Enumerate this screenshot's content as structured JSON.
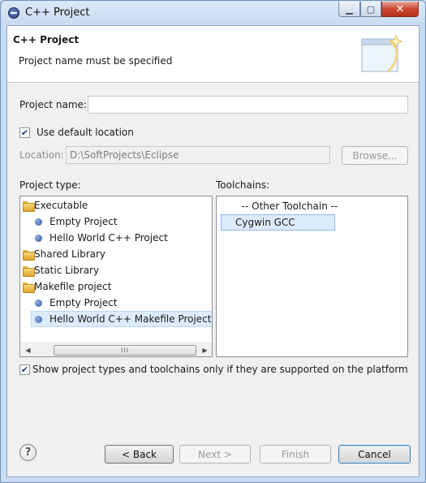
{
  "window": {
    "title": "C++ Project",
    "controls": {
      "minimize": "▁",
      "maximize": "▢",
      "close": "✕"
    }
  },
  "banner": {
    "title": "C++ Project",
    "message": "Project name must be specified"
  },
  "project_name": {
    "label": "Project name:",
    "value": ""
  },
  "default_location": {
    "label": "Use default location",
    "checked": true
  },
  "location": {
    "label": "Location:",
    "value": "D:\\SoftProjects\\Eclipse",
    "browse_label": "Browse..."
  },
  "project_type": {
    "label": "Project type:",
    "items": [
      {
        "label": "Executable",
        "icon": "folder-icon",
        "level": 0
      },
      {
        "label": "Empty Project",
        "icon": "project-bullet-icon",
        "level": 1
      },
      {
        "label": "Hello World C++ Project",
        "icon": "project-bullet-icon",
        "level": 1
      },
      {
        "label": "Shared Library",
        "icon": "folder-icon",
        "level": 0
      },
      {
        "label": "Static Library",
        "icon": "folder-icon",
        "level": 0
      },
      {
        "label": "Makefile project",
        "icon": "folder-icon",
        "level": 0
      },
      {
        "label": "Empty Project",
        "icon": "project-bullet-icon",
        "level": 1
      },
      {
        "label": "Hello World C++ Makefile Project",
        "icon": "project-bullet-icon",
        "level": 1,
        "selected": true
      }
    ],
    "scrollbar": {
      "left": "◀",
      "right": "▶",
      "grip": "III"
    }
  },
  "toolchains": {
    "label": "Toolchains:",
    "items": [
      {
        "label": "-- Other Toolchain --"
      },
      {
        "label": "Cygwin GCC",
        "selected": true
      }
    ]
  },
  "filter": {
    "label": "Show project types and toolchains only if they are supported on the platform",
    "checked": true
  },
  "buttons": {
    "help": "?",
    "back": "< Back",
    "next": "Next >",
    "finish": "Finish",
    "cancel": "Cancel"
  },
  "colors": {
    "selection": "#cce8ff",
    "selection_border": "#99d1ff"
  }
}
